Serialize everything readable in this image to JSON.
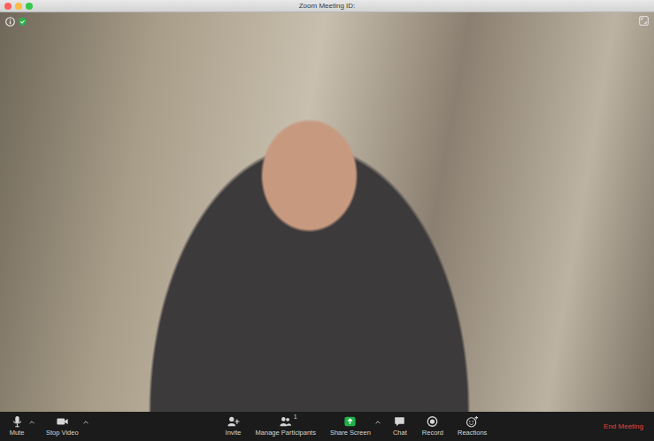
{
  "window": {
    "title": "Zoom Meeting ID:"
  },
  "toolbar": {
    "left": [
      {
        "label": "Mute",
        "has_menu": true
      },
      {
        "label": "Stop Video",
        "has_menu": true
      }
    ],
    "center": [
      {
        "label": "Invite",
        "has_menu": false
      },
      {
        "label": "Manage Participants",
        "count": "1",
        "has_menu": false
      },
      {
        "label": "Share Screen",
        "has_menu": true
      },
      {
        "label": "Chat",
        "has_menu": false
      },
      {
        "label": "Record",
        "has_menu": false
      },
      {
        "label": "Reactions",
        "has_menu": false
      }
    ]
  },
  "end_button": {
    "label": "End Meeting"
  }
}
